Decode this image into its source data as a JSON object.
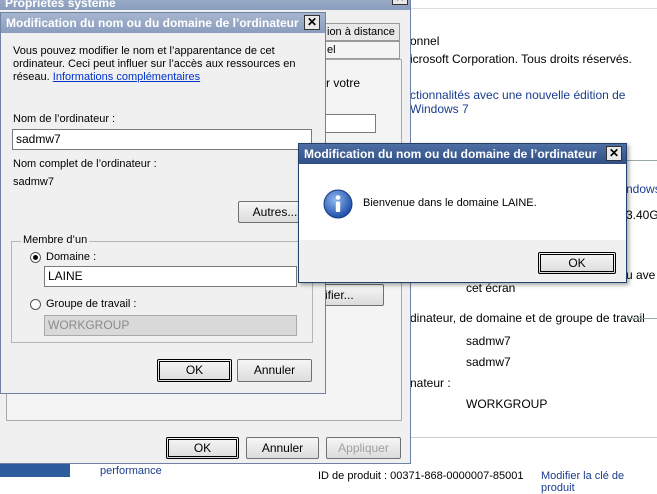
{
  "background": {
    "line_connel": "onnel",
    "line_copyright": "icrosoft Corporation. Tous droits réservés.",
    "link_features": "ctionnalités avec une nouvelle édition de Windows 7",
    "link_windows": "ndows",
    "cpu_fragment": "3.40G",
    "text_ave": "u ave",
    "text_cet_ecran": "cet écran",
    "section_heading": "dinateur, de domaine et de groupe de travail",
    "value_name": "sadmw7",
    "value_fullname": "sadmw7",
    "label_ateur": "nateur :",
    "value_workgroup": "WORKGROUP",
    "bottom_link_performance": "performance",
    "bottom_product_id": "ID de produit : 00371-868-0000007-85001",
    "bottom_link_key": "Modifier la clé de produit"
  },
  "props_window": {
    "title": "Propriétés système",
    "tab_remote": "ion à distance",
    "tab_material": "el",
    "text_votre": "r votre",
    "button_modifier_fragment": "ifier...",
    "ok_label": "OK",
    "cancel_label": "Annuler",
    "apply_label": "Appliquer"
  },
  "rename_dialog": {
    "title": "Modification du nom ou du domaine de l’ordinateur",
    "intro": "Vous pouvez modifier le nom et l’apparentance de cet ordinateur. Ceci peut influer sur l’accès aux ressources en réseau.",
    "more_info_link": "Informations complémentaires",
    "computer_name_label": "Nom de l’ordinateur :",
    "computer_name_value": "sadmw7",
    "full_name_label": "Nom complet de l’ordinateur :",
    "full_name_value": "sadmw7",
    "more_button": "Autres...",
    "member_of_label": "Membre d’un",
    "domain_label": "Domaine :",
    "domain_value": "LAINE",
    "workgroup_label": "Groupe de travail :",
    "workgroup_value": "WORKGROUP",
    "ok_label": "OK",
    "cancel_label": "Annuler"
  },
  "welcome_dialog": {
    "title": "Modification du nom ou du domaine de l’ordinateur",
    "message": "Bienvenue dans le domaine LAINE.",
    "ok_label": "OK"
  },
  "colors": {
    "active_title": "#2f4f86",
    "inactive_title": "#8a9dbd",
    "dialog_bg": "#f0f0f0",
    "link": "#0033cc"
  }
}
